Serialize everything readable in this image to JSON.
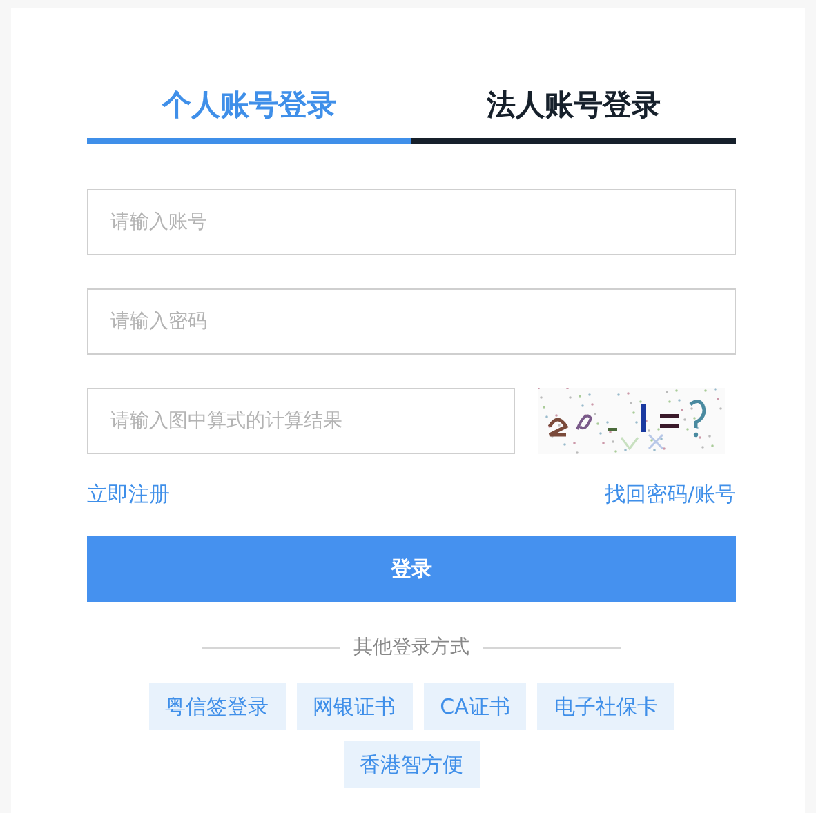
{
  "tabs": [
    {
      "label": "个人账号登录",
      "selected": true
    },
    {
      "label": "法人账号登录",
      "selected": false
    }
  ],
  "fields": [
    {
      "placeholder": "请输入账号",
      "kind": "text"
    },
    {
      "placeholder": "请输入密码",
      "kind": "password"
    },
    {
      "placeholder": "请输入图中算式的计算结果",
      "kind": "captcha"
    }
  ],
  "links": {
    "register": "立即注册",
    "recover": "找回密码/账号"
  },
  "login_button": "登录",
  "other_methods": {
    "title": "其他登录方式",
    "items": [
      "粤信签登录",
      "网银证书",
      "CA证书",
      "电子社保卡",
      "香港智方便"
    ]
  }
}
